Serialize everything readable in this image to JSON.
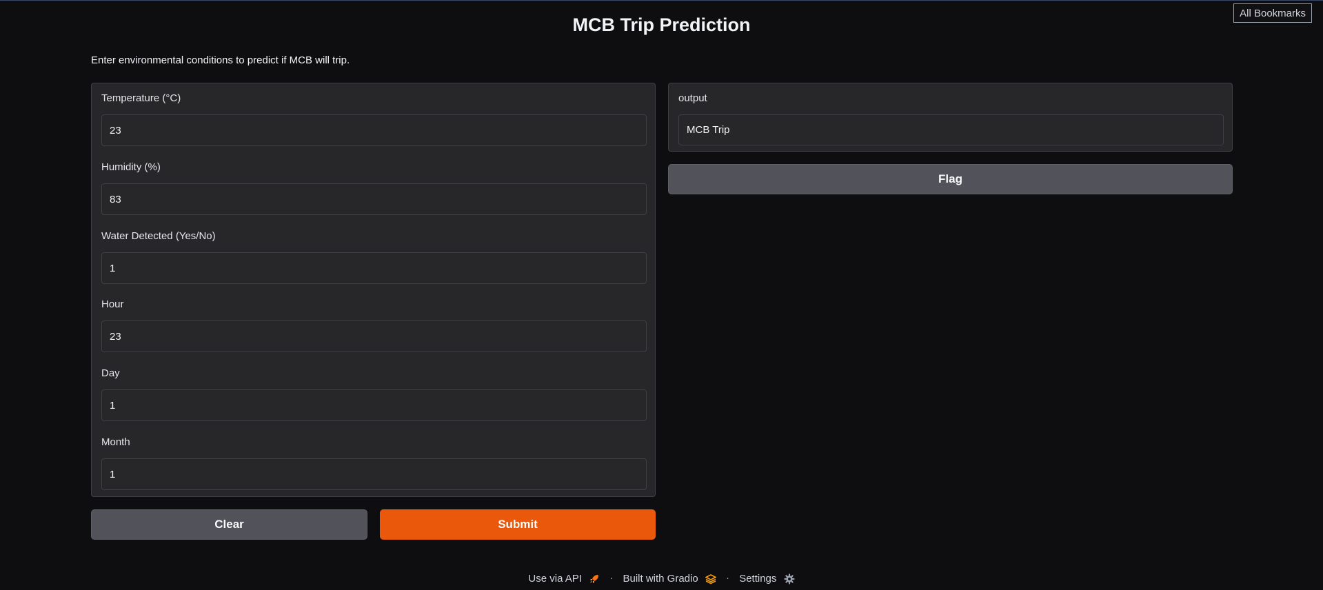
{
  "browser": {
    "bookmarks_label": "All Bookmarks"
  },
  "page": {
    "title": "MCB Trip Prediction",
    "description": "Enter environmental conditions to predict if MCB will trip."
  },
  "inputs": [
    {
      "label": "Temperature (°C)",
      "value": "23"
    },
    {
      "label": "Humidity (%)",
      "value": "83"
    },
    {
      "label": "Water Detected (Yes/No)",
      "value": "1"
    },
    {
      "label": "Hour",
      "value": "23"
    },
    {
      "label": "Day",
      "value": "1"
    },
    {
      "label": "Month",
      "value": "1"
    }
  ],
  "output": {
    "label": "output",
    "value": "MCB Trip"
  },
  "buttons": {
    "clear": "Clear",
    "submit": "Submit",
    "flag": "Flag"
  },
  "footer": {
    "api": "Use via API",
    "built": "Built with Gradio",
    "settings": "Settings",
    "separator": "·"
  },
  "colors": {
    "primary": "#ea580c",
    "secondary": "#52525b",
    "panel": "#27272a",
    "background": "#0e0e11"
  },
  "icons": {
    "api": "rocket-icon",
    "gradio": "gradio-logo-icon",
    "settings": "gear-icon"
  }
}
